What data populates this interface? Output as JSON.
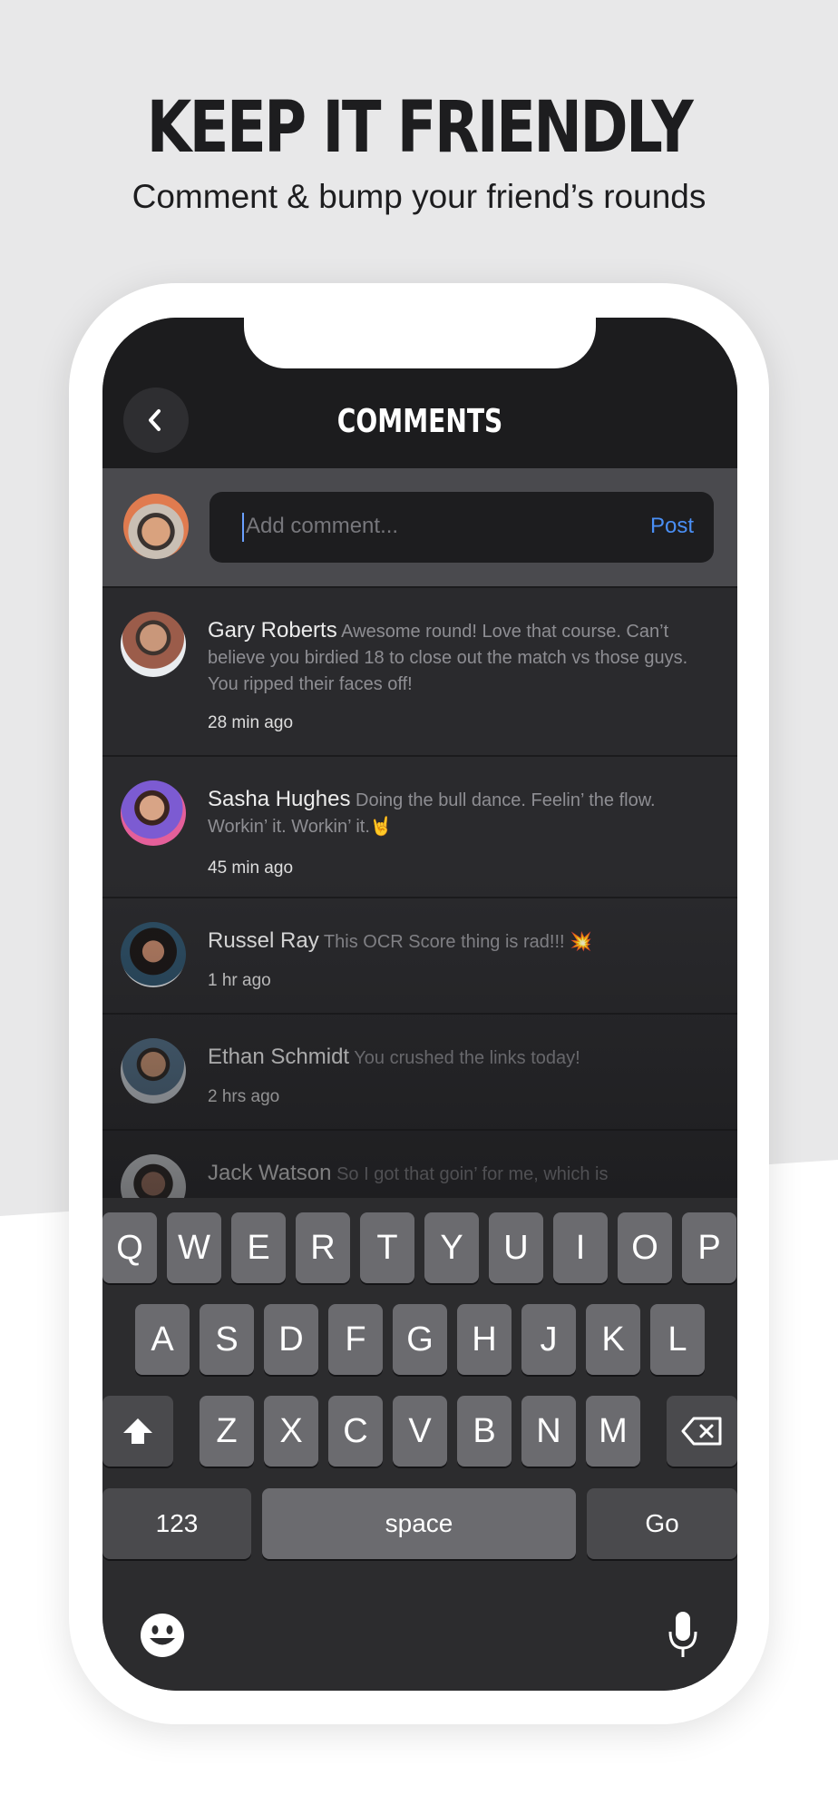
{
  "promo": {
    "headline": "KEEP IT FRIENDLY",
    "subhead": "Comment & bump your friend’s rounds"
  },
  "nav": {
    "title": "COMMENTS"
  },
  "composer": {
    "placeholder": "Add comment...",
    "post_label": "Post"
  },
  "comments": [
    {
      "name": "Gary Roberts",
      "text": "Awesome round! Love that course. Can’t believe you birdied 18 to close out the match vs those guys. You ripped their faces off!",
      "time": "28 min ago"
    },
    {
      "name": "Sasha Hughes",
      "text": "Doing the bull dance. Feelin’ the flow. Workin’ it. Workin’ it.",
      "emoji": "🤘",
      "time": "45 min ago"
    },
    {
      "name": "Russel Ray",
      "text": "This OCR Score thing is rad!!!",
      "emoji": "💥",
      "time": "1 hr ago"
    },
    {
      "name": "Ethan Schmidt",
      "text": "You crushed the links today!",
      "time": "2 hrs ago"
    },
    {
      "name": "Jack Watson",
      "text": "So I got that goin’ for me, which is",
      "time": ""
    }
  ],
  "keyboard": {
    "row1": [
      "Q",
      "W",
      "E",
      "R",
      "T",
      "Y",
      "U",
      "I",
      "O",
      "P"
    ],
    "row2": [
      "A",
      "S",
      "D",
      "F",
      "G",
      "H",
      "J",
      "K",
      "L"
    ],
    "row3": [
      "Z",
      "X",
      "C",
      "V",
      "B",
      "N",
      "M"
    ],
    "numbers_label": "123",
    "space_label": "space",
    "go_label": "Go",
    "icons": {
      "shift": "shift-icon",
      "delete": "delete-icon",
      "emoji": "emoji-icon",
      "mic": "microphone-icon"
    }
  },
  "colors": {
    "accent": "#4a8ff5",
    "background": "#e8e8e9",
    "screen": "#262628"
  }
}
